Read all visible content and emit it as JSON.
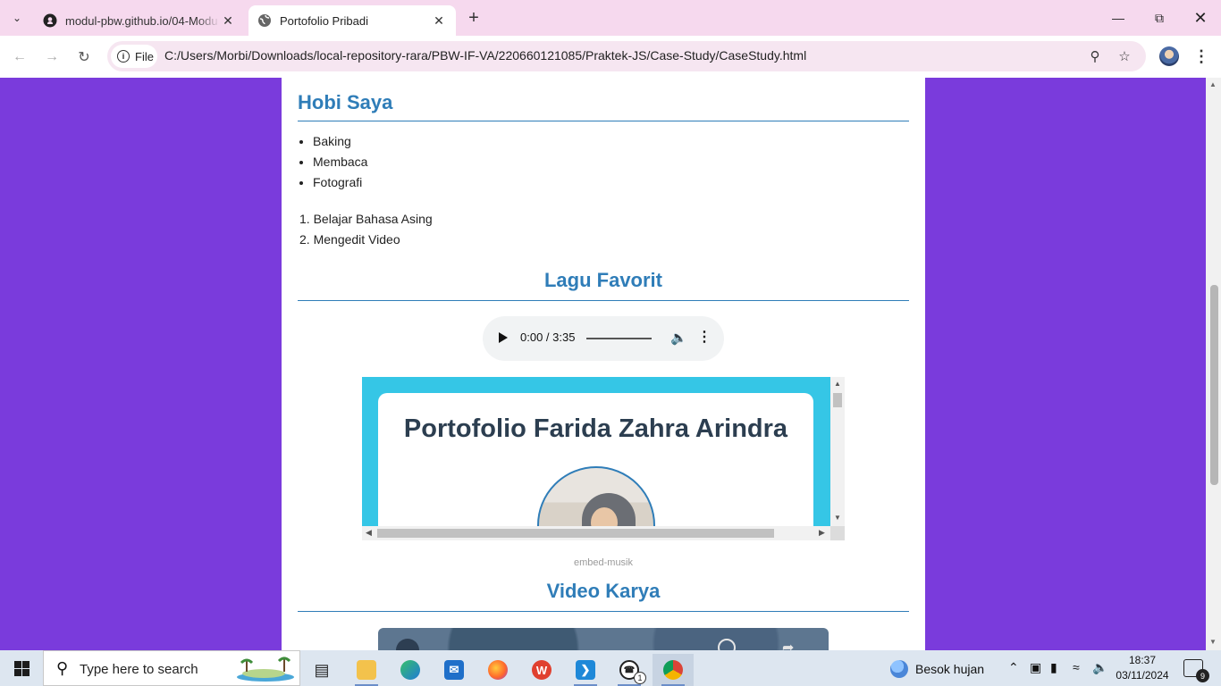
{
  "browser": {
    "tabs": [
      {
        "title": "modul-pbw.github.io/04-Modu",
        "icon": "github-icon",
        "active": false
      },
      {
        "title": "Portofolio Pribadi",
        "icon": "globe-icon",
        "active": true
      }
    ],
    "address": {
      "chip_label": "File",
      "url": "C:/Users/Morbi/Downloads/local-repository-rara/PBW-IF-VA/220660121085/Praktek-JS/Case-Study/CaseStudy.html"
    }
  },
  "page": {
    "hobby_heading": "Hobi Saya",
    "hobbies": [
      "Baking",
      "Membaca",
      "Fotografi"
    ],
    "goals": [
      "Belajar Bahasa Asing",
      "Mengedit Video"
    ],
    "song_heading": "Lagu Favorit",
    "audio": {
      "time": "0:00 / 3:35",
      "progress": 0
    },
    "embed": {
      "title": "Portofolio Farida Zahra Arindra"
    },
    "embed_caption": "embed-musik",
    "video_heading": "Video Karya"
  },
  "taskbar": {
    "search_placeholder": "Type here to search",
    "weather": "Besok hujan",
    "time": "18:37",
    "date": "03/11/2024",
    "notification_count": "9",
    "whatsapp_badge": "1"
  },
  "colors": {
    "page_background": "#7a3bdc",
    "heading": "#2f7db8",
    "embed_background": "#35c6e6",
    "tabbar": "#f6d9ee"
  }
}
